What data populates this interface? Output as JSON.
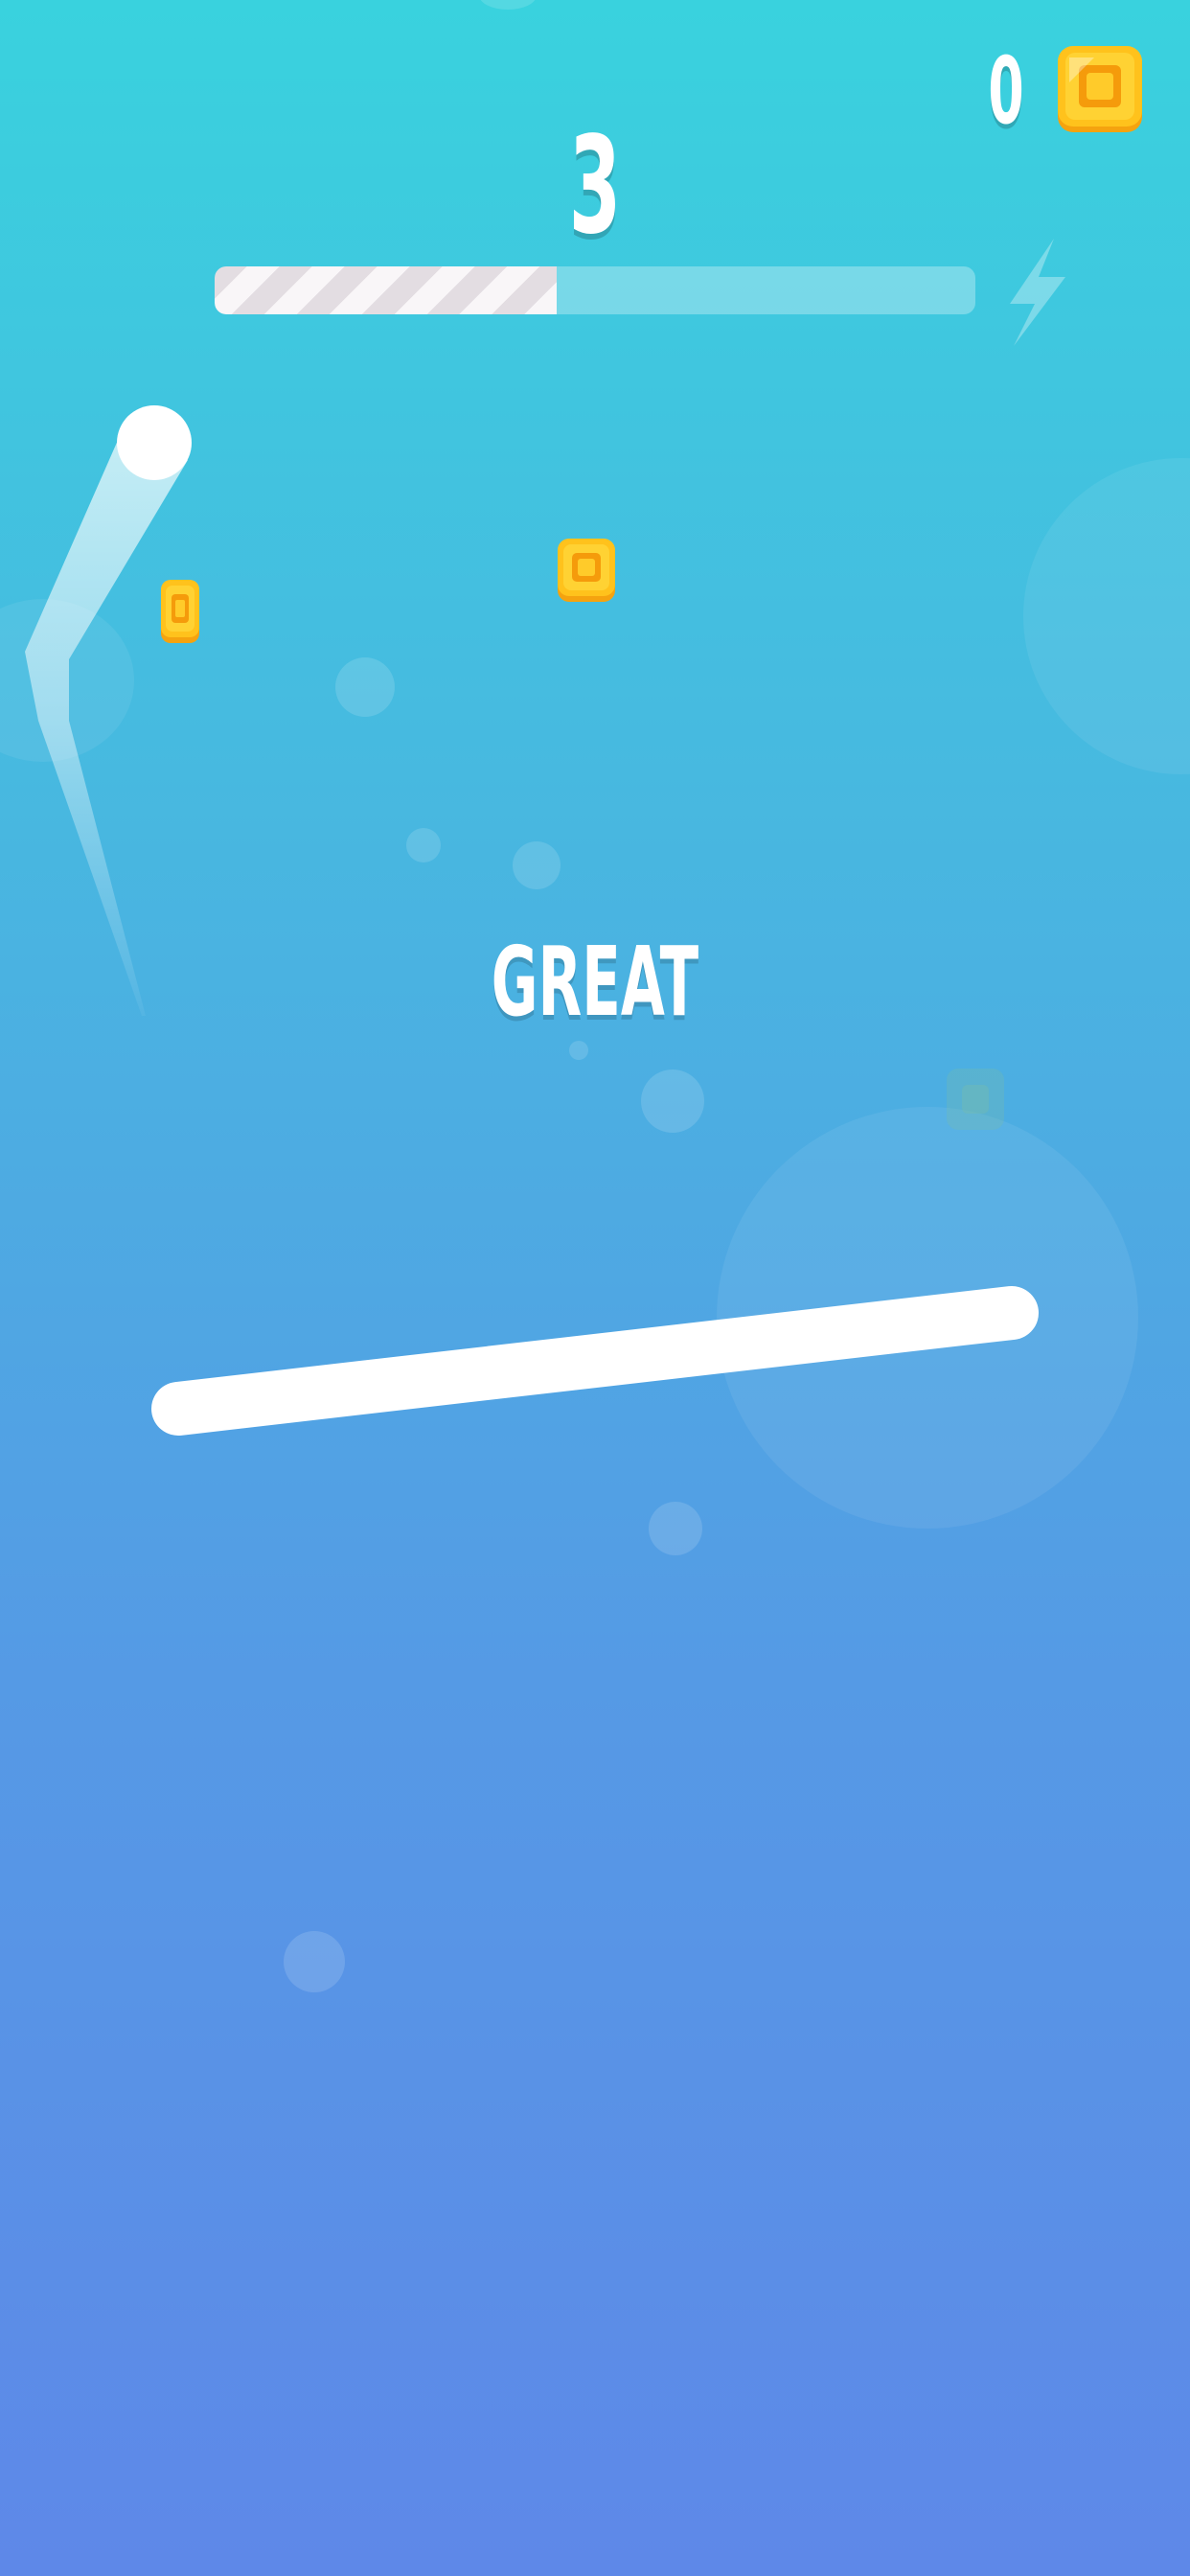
{
  "hud": {
    "coin_count": "0",
    "score": "3",
    "level_progress": 0.45,
    "power_icon": "lightning-bolt-icon",
    "coin_icon": "coin-icon"
  },
  "feedback": {
    "message": "GREAT"
  },
  "colors": {
    "background_top": "#39d2de",
    "background_bottom": "#5e88e8",
    "coin": "#ffc21c",
    "progress_stripe_light": "#f9f6f8",
    "progress_stripe_dark": "#e3dde2"
  }
}
